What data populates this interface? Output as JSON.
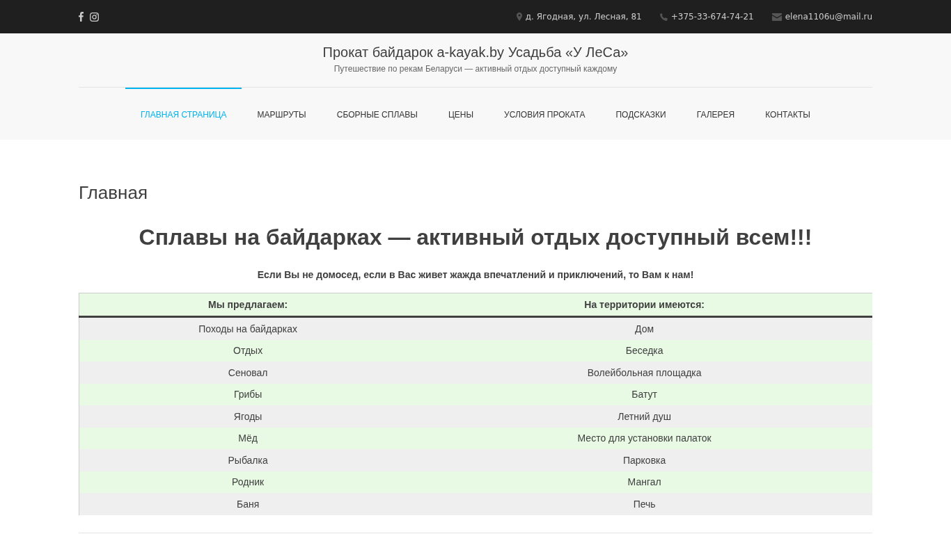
{
  "topbar": {
    "address": "д. Ягодная, ул. Лесная, 81",
    "phone": "+375-33-674-74-21",
    "email": "elena1106u@mail.ru"
  },
  "header": {
    "title": "Прокат байдарок a-kayak.by Усадьба «У ЛеСа»",
    "subtitle": "Путешествие по рекам Беларуси — активный отдых доступный каждому"
  },
  "nav": [
    {
      "label": "ГЛАВНАЯ СТРАНИЦА",
      "selected": true
    },
    {
      "label": "МАРШРУТЫ",
      "selected": false
    },
    {
      "label": "СБОРНЫЕ СПЛАВЫ",
      "selected": false
    },
    {
      "label": "ЦЕНЫ",
      "selected": false
    },
    {
      "label": "УСЛОВИЯ ПРОКАТА",
      "selected": false
    },
    {
      "label": "ПОДСКАЗКИ",
      "selected": false
    },
    {
      "label": "ГАЛЕРЕЯ",
      "selected": false
    },
    {
      "label": "КОНТАКТЫ",
      "selected": false
    }
  ],
  "page_title": "Главная",
  "headline": "Сплавы на байдарках — активный отдых доступный всем!!!",
  "intro": "Если Вы не домосед, если в Вас живет жажда впечатлений и приключений, то Вам к нам!",
  "table": {
    "columns": [
      "Мы предлагаем:",
      "На территории имеются:"
    ],
    "rows": [
      [
        "Походы на байдарках",
        "Дом"
      ],
      [
        "Отдых",
        "Беседка"
      ],
      [
        "Сеновал",
        "Волейбольная площадка"
      ],
      [
        "Грибы",
        "Батут"
      ],
      [
        "Ягоды",
        "Летний душ"
      ],
      [
        "Мёд",
        "Место для установки палаток"
      ],
      [
        "Рыбалка",
        "Парковка"
      ],
      [
        "Родник",
        "Мангал"
      ],
      [
        "Баня",
        "Печь"
      ]
    ]
  }
}
